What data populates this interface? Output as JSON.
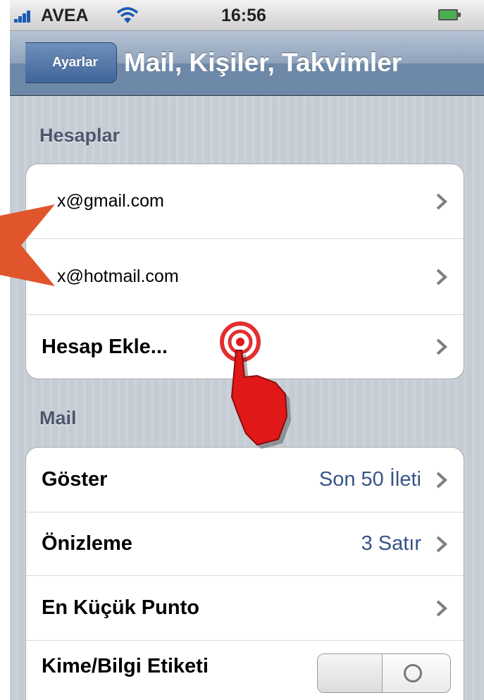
{
  "status_bar": {
    "carrier": "AVEA",
    "time": "16:56"
  },
  "nav": {
    "back_label": "Ayarlar",
    "title": "Mail, Kişiler, Takvimler"
  },
  "sections": {
    "accounts": {
      "header": "Hesaplar",
      "rows": [
        {
          "label": "x@gmail.com"
        },
        {
          "label": "x@hotmail.com"
        },
        {
          "label": "Hesap Ekle..."
        }
      ]
    },
    "mail": {
      "header": "Mail",
      "rows": [
        {
          "label": "Göster",
          "value": "Son 50 İleti"
        },
        {
          "label": "Önizleme",
          "value": "3 Satır"
        },
        {
          "label": "En Küçük Punto"
        },
        {
          "label": "Kime/Bilgi Etiketi",
          "toggle": "off"
        }
      ]
    }
  },
  "colors": {
    "value_text": "#385487",
    "section_header": "#4c566c",
    "annotation_arrow": "#e0552b",
    "tap_highlight": "#e01818"
  },
  "icons": [
    "signal-icon",
    "wifi-icon",
    "battery-icon",
    "chevron-right-icon",
    "pointer-arrow-icon",
    "tap-hand-icon"
  ]
}
